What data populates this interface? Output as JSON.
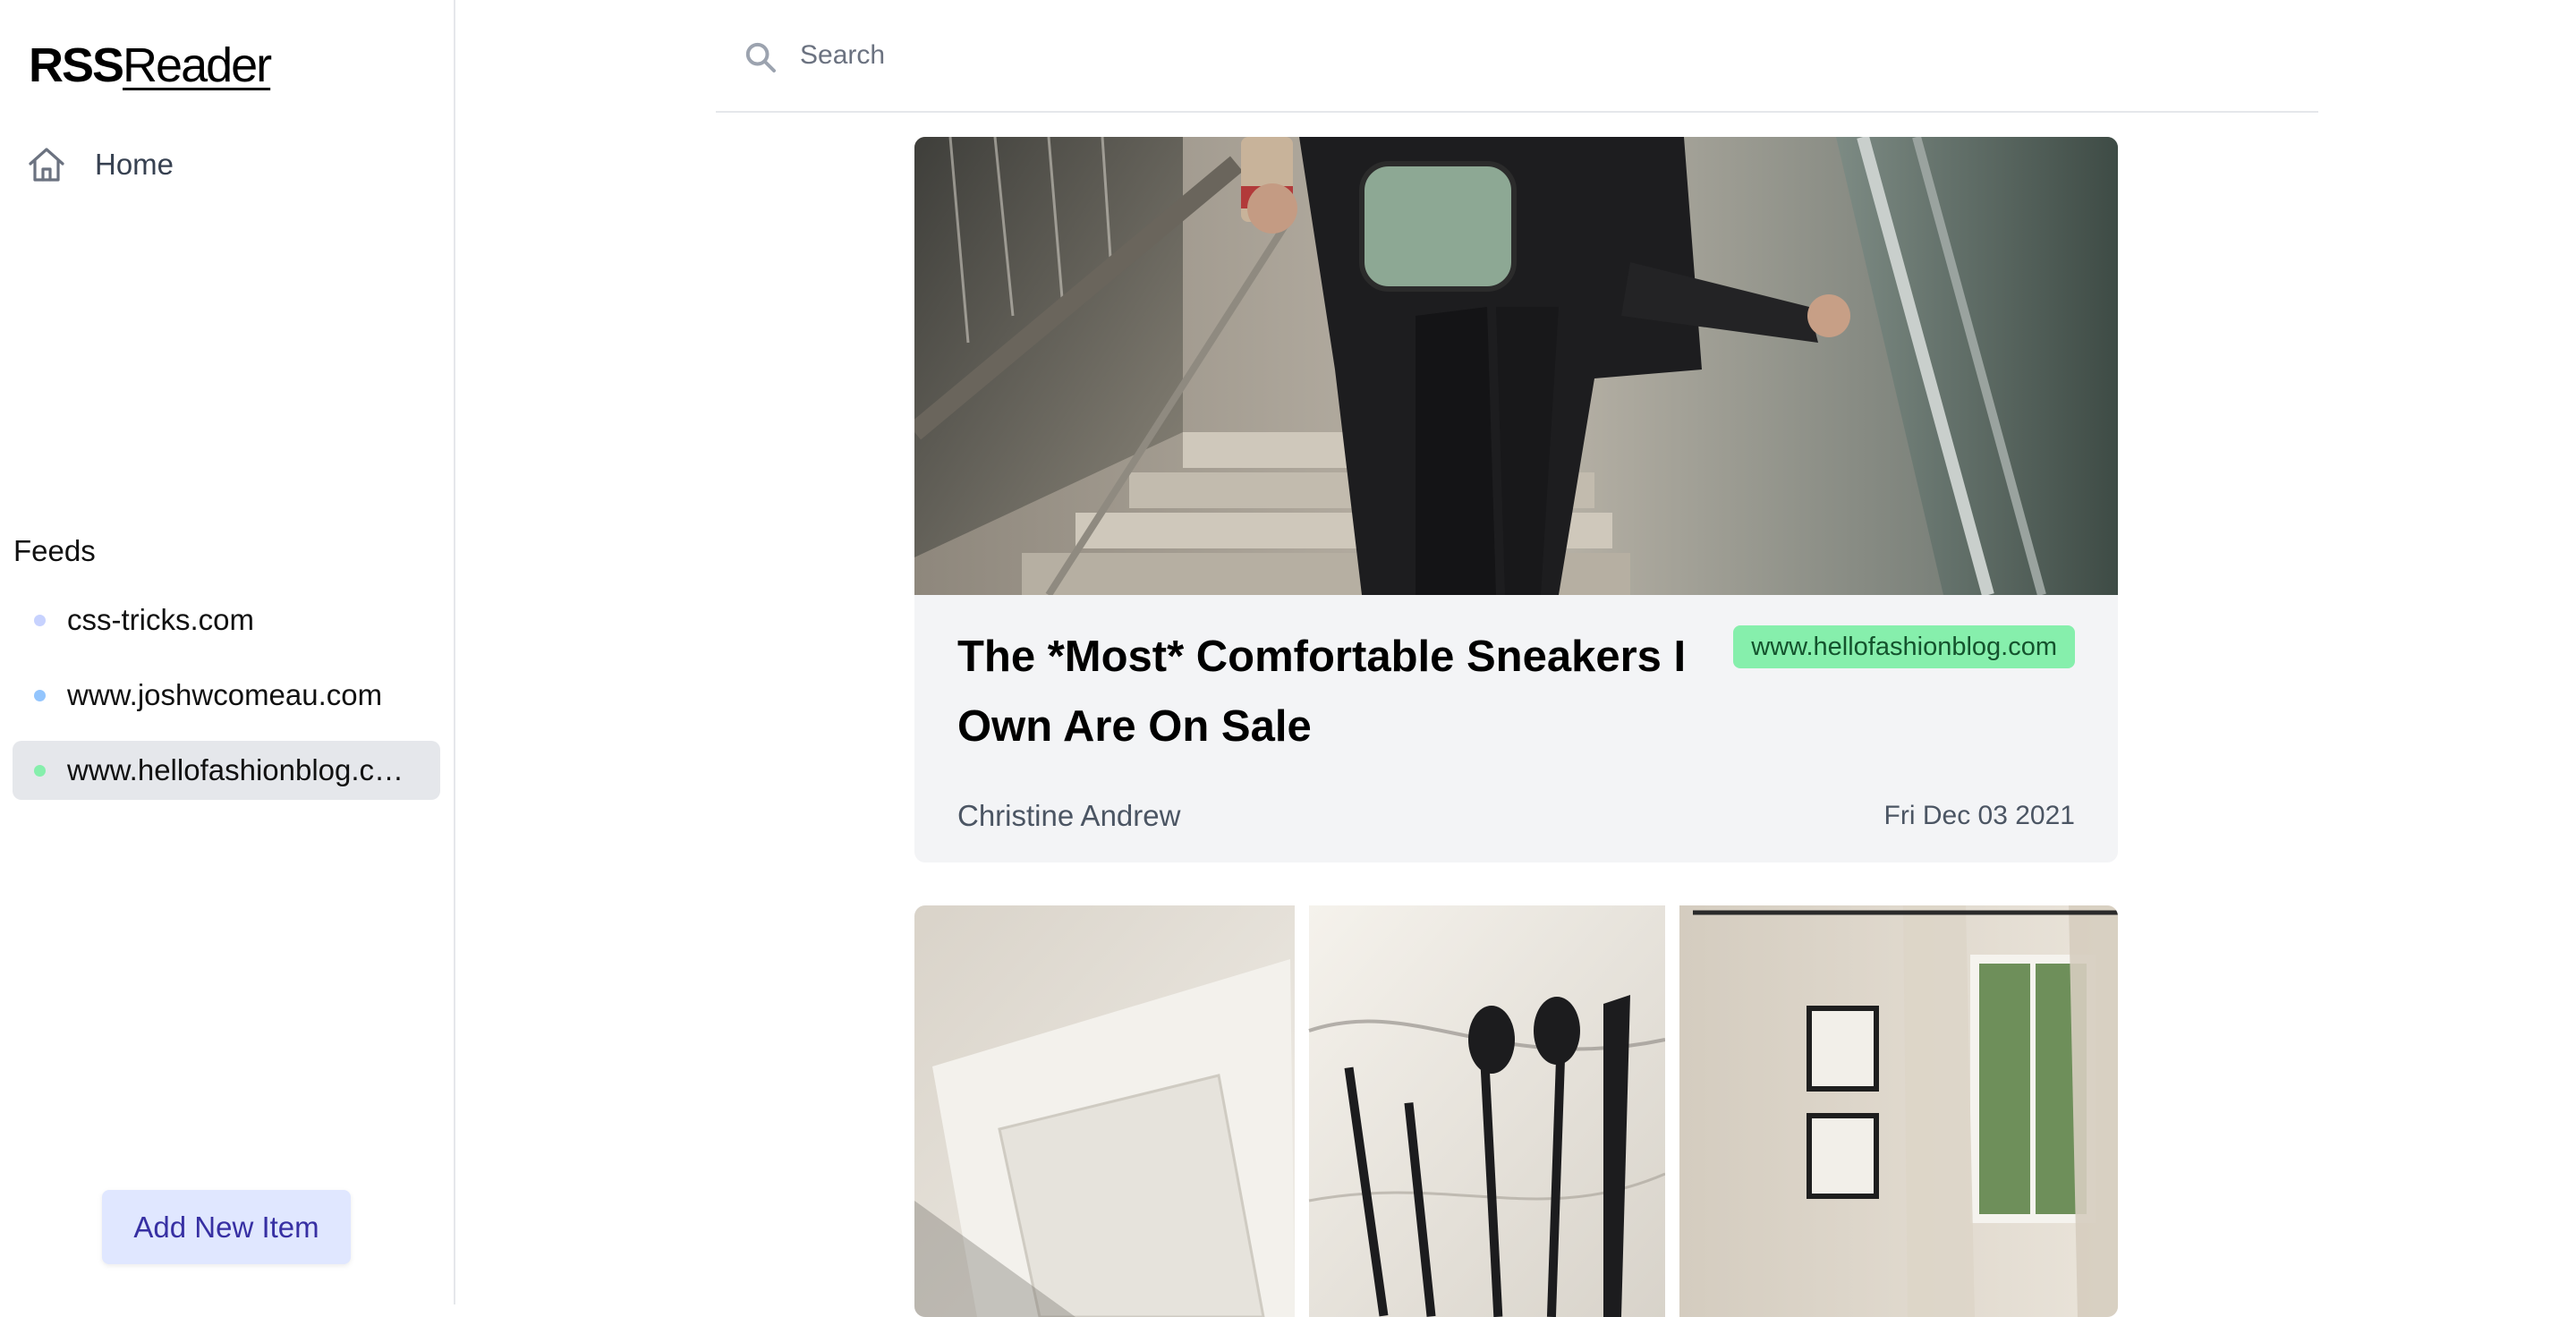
{
  "app": {
    "logo_bold": "RSS",
    "logo_light": "Reader"
  },
  "nav": {
    "home_label": "Home",
    "home_icon": "home-icon"
  },
  "feeds": {
    "title": "Feeds",
    "items": [
      {
        "label": "css-tricks.com",
        "dot_color": "#c7d2fe",
        "active": false
      },
      {
        "label": "www.joshwcomeau.com",
        "dot_color": "#93c5fd",
        "active": false
      },
      {
        "label": "www.hellofashionblog.com",
        "dot_color": "#86efac",
        "active": true
      }
    ]
  },
  "sidebar": {
    "add_button_label": "Add New Item"
  },
  "search": {
    "placeholder": "Search",
    "value": "",
    "icon": "search-icon"
  },
  "articles": [
    {
      "title": "The *Most* Comfortable Sneakers I Own Are On Sale",
      "source": "www.hellofashionblog.com",
      "author": "Christine Andrew",
      "date": "Fri Dec 03 2021",
      "image_alt": "Person on stairs holding a coffee cup, wearing a black puffer vest and a The North Face belt bag"
    },
    {
      "image_alt": "Collage: coffee table book, black cutlery on marble, framed pictures by a window"
    }
  ],
  "colors": {
    "accent_button_bg": "#e0e7ff",
    "accent_button_text": "#3730a3",
    "source_badge_bg": "#86efac",
    "active_feed_bg": "#e5e7eb",
    "card_bg": "#f3f4f6"
  }
}
